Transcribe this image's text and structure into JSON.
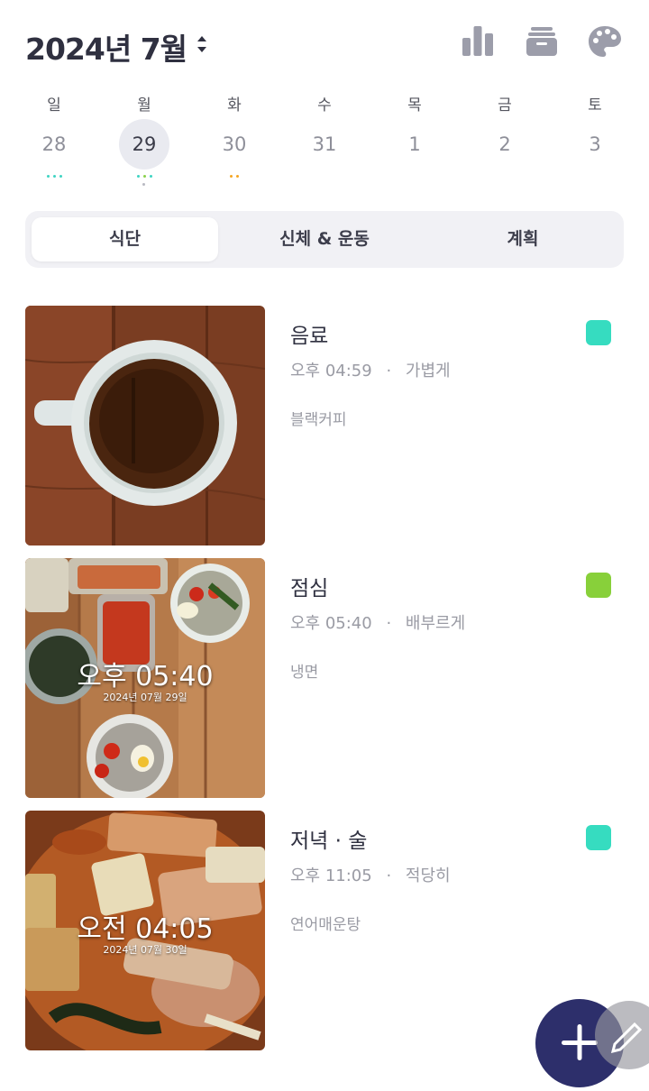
{
  "header": {
    "title": "2024년 7월",
    "icons": [
      "sort-updown-icon",
      "bar-chart-icon",
      "archive-box-icon",
      "palette-icon"
    ]
  },
  "week": {
    "days": [
      {
        "dow": "일",
        "date": "28",
        "dots": [
          "#3fd4c3",
          "#3fd4c3",
          "#3fd4c3"
        ],
        "selected": false
      },
      {
        "dow": "월",
        "date": "29",
        "dots": [
          "#3fd4c3",
          "#8ad14a",
          "#3fd4c3"
        ],
        "selected": true
      },
      {
        "dow": "화",
        "date": "30",
        "dots": [
          "#f5a623",
          "#f5a623"
        ],
        "selected": false
      },
      {
        "dow": "수",
        "date": "31",
        "dots": [],
        "selected": false
      },
      {
        "dow": "목",
        "date": "1",
        "dots": [],
        "selected": false
      },
      {
        "dow": "금",
        "date": "2",
        "dots": [],
        "selected": false
      },
      {
        "dow": "토",
        "date": "3",
        "dots": [],
        "selected": false
      }
    ]
  },
  "tabs": [
    {
      "label": "식단",
      "active": true
    },
    {
      "label": "신체 & 운동",
      "active": false
    },
    {
      "label": "계획",
      "active": false
    }
  ],
  "entries": [
    {
      "meal": "음료",
      "time": "오후 04:59",
      "sep": "·",
      "portion": "가볍게",
      "food": "블랙커피",
      "tag_color": "#36dcc0",
      "photo": "coffee",
      "overlay_time": "",
      "overlay_date": ""
    },
    {
      "meal": "점심",
      "time": "오후 05:40",
      "sep": "·",
      "portion": "배부르게",
      "food": "냉면",
      "tag_color": "#88d03a",
      "photo": "lunch",
      "overlay_time": "오후 05:40",
      "overlay_date": "2024년 07월 29일"
    },
    {
      "meal": "저녁 · 술",
      "time": "오후 11:05",
      "sep": "·",
      "portion": "적당히",
      "food": "연어매운탕",
      "tag_color": "#36dcc0",
      "photo": "stew",
      "overlay_time": "오전 04:05",
      "overlay_date": "2024년 07월 30일"
    }
  ],
  "fab": {
    "icon": "plus-icon",
    "secondary_icon": "pencil-icon"
  },
  "colors": {
    "accent": "#2d2f6b",
    "icon_gray": "#9c9daa"
  }
}
